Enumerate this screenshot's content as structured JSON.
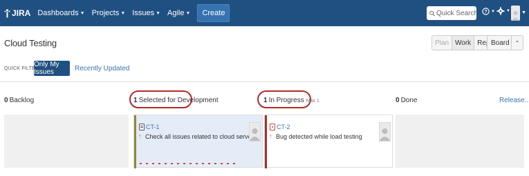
{
  "app": {
    "logo_text": "JIRA",
    "brand_color": "#205081"
  },
  "nav": {
    "items": [
      {
        "label": "Dashboards"
      },
      {
        "label": "Projects"
      },
      {
        "label": "Issues"
      },
      {
        "label": "Agile"
      }
    ],
    "create_label": "Create"
  },
  "search": {
    "placeholder": "Quick Search"
  },
  "page": {
    "title": "Cloud Testing"
  },
  "modes": {
    "plan": "Plan",
    "work": "Work",
    "report": "Report",
    "board": "Board",
    "active": "Work"
  },
  "quick_filters": {
    "label": "QUICK FILTERS:",
    "active": "Only My Issues",
    "link": "Recently Updated"
  },
  "columns": [
    {
      "count": "0",
      "name": "Backlog",
      "max": ""
    },
    {
      "count": "1",
      "name": "Selected for Development",
      "max": ""
    },
    {
      "count": "1",
      "name": "In Progress",
      "max": "Max 1"
    },
    {
      "count": "0",
      "name": "Done",
      "max": ""
    }
  ],
  "release_link": "Release...",
  "cards": [
    {
      "key": "CT-1",
      "type": "task-icon",
      "priority": "high-priority-arrow-icon",
      "summary": "Check all issues related to cloud server",
      "grabber_color": "#8b8b3a"
    },
    {
      "key": "CT-2",
      "type": "bug-icon",
      "priority": "high-priority-arrow-icon",
      "summary": "Bug detected while load testing",
      "grabber_color": "#b02a2a"
    }
  ],
  "colors": {
    "link": "#3b73af",
    "highlight": "#b02a2a"
  }
}
